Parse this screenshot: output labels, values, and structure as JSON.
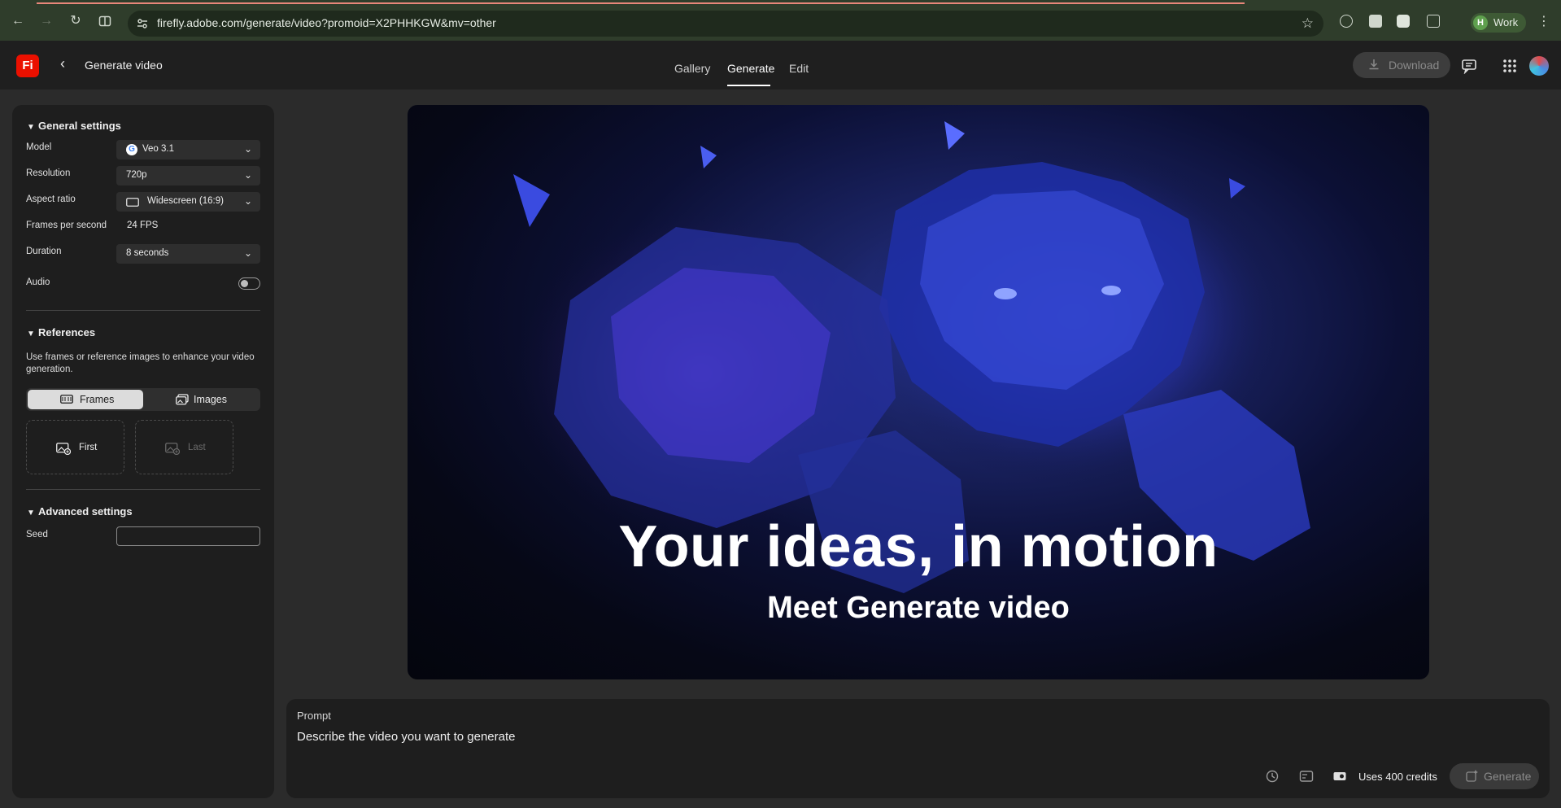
{
  "browser": {
    "url": "firefly.adobe.com/generate/video?promoid=X2PHHKGW&mv=other",
    "profile_initial": "H",
    "profile_label": "Work"
  },
  "app": {
    "logo_text": "Fi",
    "title": "Generate video",
    "tabs": [
      {
        "label": "Gallery"
      },
      {
        "label": "Generate"
      },
      {
        "label": "Edit"
      }
    ],
    "active_tab": "Generate",
    "download_label": "Download"
  },
  "general_settings": {
    "heading": "General settings",
    "model_label": "Model",
    "model_value": "Veo 3.1",
    "resolution_label": "Resolution",
    "resolution_value": "720p",
    "aspect_label": "Aspect ratio",
    "aspect_value": "Widescreen (16:9)",
    "fps_label": "Frames per second",
    "fps_value": "24 FPS",
    "duration_label": "Duration",
    "duration_value": "8 seconds",
    "audio_label": "Audio",
    "audio_on": false
  },
  "references": {
    "heading": "References",
    "description": "Use frames or reference images to enhance your video generation.",
    "frames_label": "Frames",
    "images_label": "Images",
    "first_label": "First",
    "last_label": "Last"
  },
  "advanced_settings": {
    "heading": "Advanced settings",
    "seed_label": "Seed",
    "seed_value": ""
  },
  "hero": {
    "title": "Your ideas, in motion",
    "subtitle": "Meet Generate video"
  },
  "prompt": {
    "label": "Prompt",
    "placeholder": "Describe the video you want to generate",
    "credits": "Uses 400 credits",
    "generate_label": "Generate"
  },
  "colors": {
    "accent_red": "#eb1000",
    "browser_frame": "#2f3d2b",
    "panel": "#1e1e1e"
  }
}
